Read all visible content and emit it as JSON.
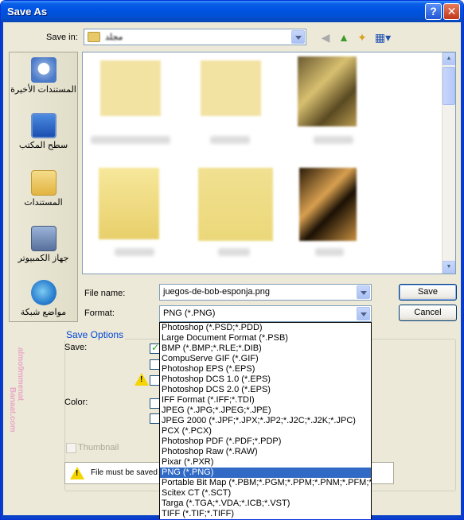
{
  "window": {
    "title": "Save As",
    "help_glyph": "?",
    "close_glyph": "✕"
  },
  "save_in": {
    "label": "Save in:",
    "value": "مجلد"
  },
  "places": [
    {
      "label": "المستندات الأخيرة",
      "icon": "recent-documents-icon"
    },
    {
      "label": "سطح المكتب",
      "icon": "desktop-icon"
    },
    {
      "label": "المستندات",
      "icon": "my-documents-icon"
    },
    {
      "label": "جهاز الكمبيوتر",
      "icon": "my-computer-icon"
    },
    {
      "label": "مواضع شبكة",
      "icon": "network-places-icon"
    }
  ],
  "file_name": {
    "label": "File name:",
    "value": "juegos-de-bob-esponja.png"
  },
  "format": {
    "label": "Format:",
    "value": "PNG (*.PNG)"
  },
  "buttons": {
    "save": "Save",
    "cancel": "Cancel"
  },
  "save_options": {
    "title": "Save Options",
    "save_label": "Save:",
    "color_label": "Color:",
    "thumbnail_label": "Thumbnail",
    "warning_text": "File must be saved"
  },
  "format_options": [
    "Photoshop (*.PSD;*.PDD)",
    "Large Document Format (*.PSB)",
    "BMP (*.BMP;*.RLE;*.DIB)",
    "CompuServe GIF (*.GIF)",
    "Photoshop EPS (*.EPS)",
    "Photoshop DCS 1.0 (*.EPS)",
    "Photoshop DCS 2.0 (*.EPS)",
    "IFF Format (*.IFF;*.TDI)",
    "JPEG (*.JPG;*.JPEG;*.JPE)",
    "JPEG 2000 (*.JPF;*.JPX;*.JP2;*.J2C;*.J2K;*.JPC)",
    "PCX (*.PCX)",
    "Photoshop PDF (*.PDF;*.PDP)",
    "Photoshop Raw (*.RAW)",
    "Pixar (*.PXR)",
    "PNG (*.PNG)",
    "Portable Bit Map (*.PBM;*.PGM;*.PPM;*.PNM;*.PFM;*.PAM)",
    "Scitex CT (*.SCT)",
    "Targa (*.TGA;*.VDA;*.ICB;*.VST)",
    "TIFF (*.TIF;*.TIFF)"
  ],
  "selected_format_index": 14,
  "watermark": {
    "line1": "almo9mmenat",
    "line2": "Banaat.com"
  },
  "colors": {
    "titlebar": "#0054e3",
    "selection": "#316ac5",
    "options_title": "#0046d5",
    "watermark": "#e9a0c4"
  }
}
